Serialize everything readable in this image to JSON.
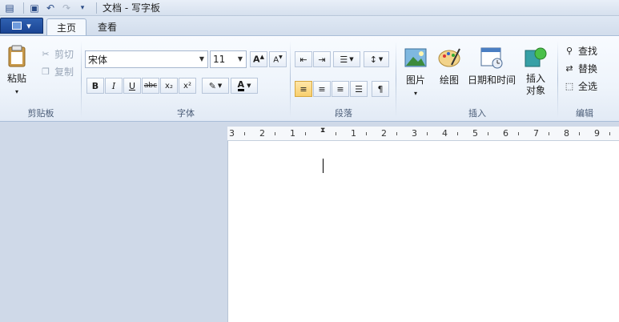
{
  "titlebar": {
    "title": "文档 - 写字板",
    "quick_access": [
      "save-icon",
      "undo-icon",
      "redo-icon",
      "dropdown-icon"
    ]
  },
  "tabs": [
    {
      "label": "主页",
      "active": true
    },
    {
      "label": "查看",
      "active": false
    }
  ],
  "ribbon": {
    "clipboard": {
      "label": "剪贴板",
      "paste": "粘贴",
      "cut": "剪切",
      "copy": "复制"
    },
    "font": {
      "label": "字体",
      "family": "宋体",
      "size": "11",
      "bold": "B",
      "italic": "I",
      "underline": "U",
      "strikethrough": "abc",
      "subscript": "x₂",
      "superscript": "x²",
      "color_letter": "A"
    },
    "paragraph": {
      "label": "段落"
    },
    "insert": {
      "label": "插入",
      "picture": "图片",
      "paint": "绘图",
      "datetime": "日期和时间",
      "object": "插入对象"
    },
    "edit": {
      "label": "编辑",
      "find": "查找",
      "replace": "替换",
      "select_all": "全选"
    }
  },
  "ruler": {
    "labels": [
      "3",
      "2",
      "1",
      "1",
      "2",
      "3",
      "4",
      "5",
      "6",
      "7",
      "8",
      "9"
    ]
  },
  "colors": {
    "accent": "#1b4594",
    "ribbon_bg": "#eef4fb",
    "workspace": "#cfd9e8",
    "active_toggle": "#f8cf6d"
  }
}
